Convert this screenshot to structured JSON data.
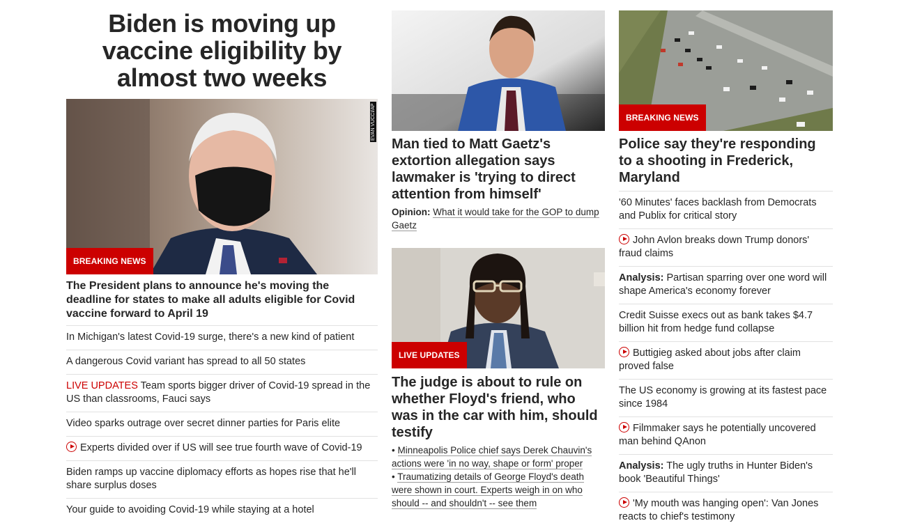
{
  "colors": {
    "brand_red": "#cc0000",
    "text": "#262626",
    "divider": "#e1e1e1"
  },
  "column1": {
    "banner_headline": "Biden is moving up vaccine eligibility by almost two weeks",
    "image_credit": "EVAN VUCCI/AP",
    "badge": "BREAKING NEWS",
    "lead_headline": "The President plans to announce he's moving the deadline for states to make all adults eligible for Covid vaccine forward to April 19",
    "items": [
      {
        "text": "In Michigan's latest Covid-19 surge, there's a new kind of patient"
      },
      {
        "text": "A dangerous Covid variant has spread to all 50 states"
      },
      {
        "label": "LIVE UPDATES",
        "text": " Team sports bigger driver of Covid-19 spread in the US than classrooms, Fauci says"
      },
      {
        "text": "Video sparks outrage over secret dinner parties for Paris elite"
      },
      {
        "icon": "play-icon",
        "text": "Experts divided over if US will see true fourth wave of Covid-19"
      },
      {
        "text": "Biden ramps up vaccine diplomacy efforts as hopes rise that he'll share surplus doses"
      },
      {
        "text": "Your guide to avoiding Covid-19 while staying at a hotel"
      }
    ]
  },
  "column2": {
    "story1": {
      "headline": "Man tied to Matt Gaetz's extortion allegation says lawmaker is 'trying to direct attention from himself'",
      "opinion_label": "Opinion:",
      "opinion_text": "What it would take for the GOP to dump Gaetz"
    },
    "story2": {
      "badge": "LIVE UPDATES",
      "headline": "The judge is about to rule on whether Floyd's friend, who was in the car with him, should testify",
      "bullet": "•",
      "links": [
        "Minneapolis Police chief says Derek Chauvin's actions were 'in no way, shape or form' proper",
        "Traumatizing details of George Floyd's death were shown in court. Experts weigh in on who should -- and shouldn't -- see them"
      ]
    }
  },
  "column3": {
    "badge": "BREAKING NEWS",
    "lead_headline": "Police say they're responding to a shooting in Frederick, Maryland",
    "items": [
      {
        "text": "'60 Minutes' faces backlash from Democrats and Publix for critical story"
      },
      {
        "icon": "play-icon",
        "text": "John Avlon breaks down Trump donors' fraud claims"
      },
      {
        "label": "Analysis:",
        "text": " Partisan sparring over one word will shape America's economy forever"
      },
      {
        "text": "Credit Suisse execs out as bank takes $4.7 billion hit from hedge fund collapse"
      },
      {
        "icon": "play-icon",
        "text": "Buttigieg asked about jobs after claim proved false"
      },
      {
        "text": "The US economy is growing at its fastest pace since 1984"
      },
      {
        "icon": "play-icon",
        "text": "Filmmaker says he potentially uncovered man behind QAnon"
      },
      {
        "label": "Analysis:",
        "text": " The ugly truths in Hunter Biden's book 'Beautiful Things'"
      },
      {
        "icon": "play-icon",
        "text": "'My mouth was hanging open': Van Jones reacts to chief's testimony"
      }
    ]
  }
}
